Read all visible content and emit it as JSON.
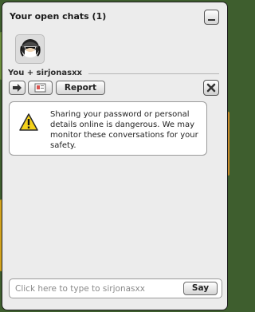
{
  "panel": {
    "title": "Your open chats (1)"
  },
  "conversation": {
    "participants_label": "You + sirjonasxx",
    "report_label": "Report"
  },
  "safety_notice": {
    "text": "Sharing your password or personal details online is dangerous. We may monitor these conversations for your safety."
  },
  "composer": {
    "placeholder": "Click here to type to sirjonasxx",
    "value": "",
    "send_label": "Say"
  },
  "icons": {
    "minimize": "minimize-icon",
    "avatar": "user-avatar",
    "arrow": "arrow-right-icon",
    "profile_card": "profile-card-icon",
    "close": "close-x-icon",
    "warning": "warning-triangle-icon"
  },
  "colors": {
    "panel_bg": "#ececec",
    "warning_yellow": "#f5d21a"
  }
}
